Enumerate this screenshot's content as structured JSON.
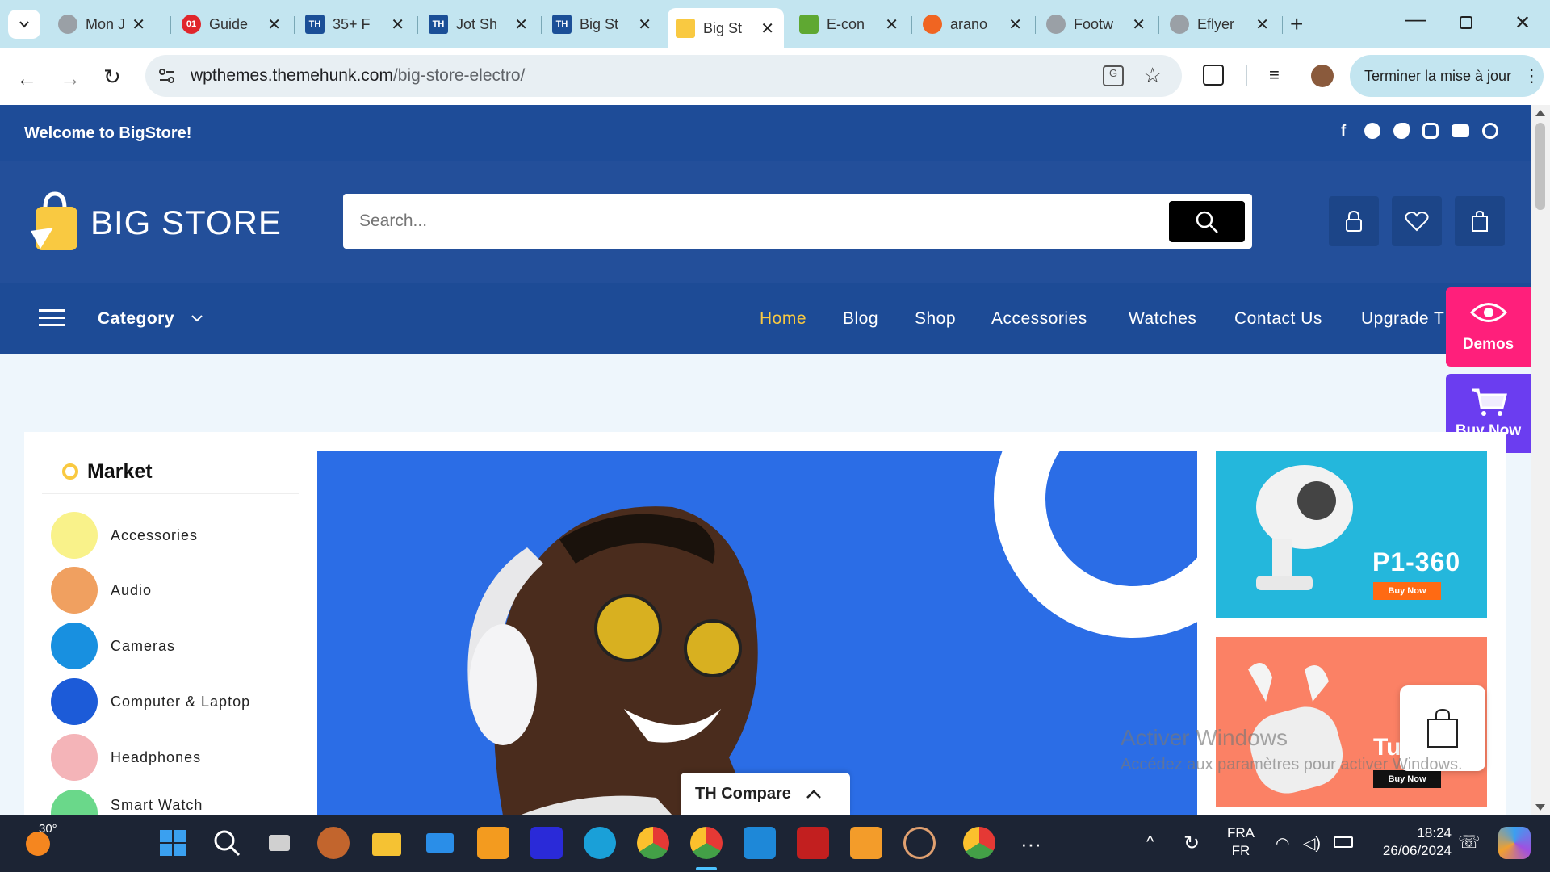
{
  "browser": {
    "tabs": [
      {
        "title": "Mon J",
        "active": false
      },
      {
        "title": "Guide",
        "active": false
      },
      {
        "title": "35+ F",
        "active": false
      },
      {
        "title": "Jot Sh",
        "active": false
      },
      {
        "title": "Big St",
        "active": false
      },
      {
        "title": "Big St",
        "active": true
      },
      {
        "title": "E-con",
        "active": false
      },
      {
        "title": "arano",
        "active": false
      },
      {
        "title": "Footw",
        "active": false
      },
      {
        "title": "Eflyer",
        "active": false
      }
    ],
    "url_host": "wpthemes.themehunk.com",
    "url_path": "/big-store-electro/",
    "update_button": "Terminer la mise à jour"
  },
  "site": {
    "welcome": "Welcome to BigStore!",
    "logo": "BIG STORE",
    "search_placeholder": "Search...",
    "category_label": "Category",
    "nav": [
      "Home",
      "Blog",
      "Shop",
      "Accessories",
      "Watches",
      "Contact Us",
      "Upgrade T"
    ],
    "side_demos": "Demos",
    "side_buy": "Buy Now",
    "market_title": "Market",
    "categories": [
      "Accessories",
      "Audio",
      "Cameras",
      "Computer & Laptop",
      "Headphones",
      "Smart Watch"
    ],
    "promo1": {
      "title": "P1-360",
      "button": "Buy Now"
    },
    "promo2": {
      "title": "Tu",
      "button": "Buy Now"
    },
    "compare_label": "TH Compare",
    "colors": {
      "topbar": "#1e4c98",
      "header": "#234f9a",
      "nav_active": "#f9c941",
      "demos": "#ff1f7b",
      "buy": "#6b3df0"
    }
  },
  "watermark": {
    "line1": "Activer Windows",
    "line2": "Accédez aux paramètres pour activer Windows."
  },
  "taskbar": {
    "temperature": "30°",
    "lang1": "FRA",
    "lang2": "FR",
    "time": "18:24",
    "date": "26/06/2024"
  }
}
